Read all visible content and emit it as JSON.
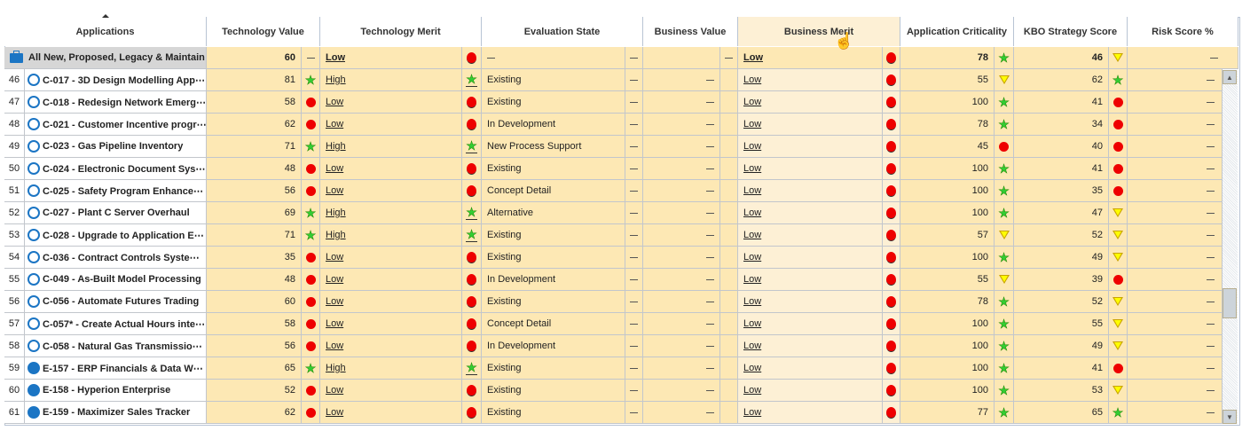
{
  "columns": [
    "Applications",
    "Technology Value",
    "Technology Merit",
    "Evaluation State",
    "Business Value",
    "Business Merit",
    "Application Criticality",
    "KBO Strategy Score",
    "Risk Score %"
  ],
  "summary": {
    "name": "All New, Proposed, Legacy & Maintain",
    "tech_value": "60",
    "tech_value_icon": "dash",
    "tech_merit": "Low",
    "tech_merit_icon": "red-dot",
    "eval_state": "—",
    "biz_merit": "Low",
    "biz_merit_icon": "red-dot",
    "criticality": "78",
    "criticality_icon": "star",
    "kbo": "46",
    "kbo_icon": "triangle"
  },
  "rows": [
    {
      "num": "46",
      "name": "C-017 - 3D Design Modelling App⋯",
      "type": "hollow",
      "tv": "81",
      "tvi": "star",
      "tm": "High",
      "tmi": "star",
      "es": "Existing",
      "bm": "Low",
      "ac": "55",
      "aci": "triangle",
      "kbo": "62",
      "kboi": "star"
    },
    {
      "num": "47",
      "name": "C-018 - Redesign Network Emerg⋯",
      "type": "hollow",
      "tv": "58",
      "tvi": "dot",
      "tm": "Low",
      "tmi": "dot",
      "es": "Existing",
      "bm": "Low",
      "ac": "100",
      "aci": "star",
      "kbo": "41",
      "kboi": "dot"
    },
    {
      "num": "48",
      "name": "C-021 - Customer Incentive progr⋯",
      "type": "hollow",
      "tv": "62",
      "tvi": "dot",
      "tm": "Low",
      "tmi": "dot",
      "es": "In Development",
      "bm": "Low",
      "ac": "78",
      "aci": "star",
      "kbo": "34",
      "kboi": "dot"
    },
    {
      "num": "49",
      "name": "C-023 - Gas Pipeline Inventory",
      "type": "hollow",
      "tv": "71",
      "tvi": "star",
      "tm": "High",
      "tmi": "star",
      "es": "New Process Support",
      "bm": "Low",
      "ac": "45",
      "aci": "dot",
      "kbo": "40",
      "kboi": "dot"
    },
    {
      "num": "50",
      "name": "C-024 - Electronic Document Sys⋯",
      "type": "hollow",
      "tv": "48",
      "tvi": "dot",
      "tm": "Low",
      "tmi": "dot",
      "es": "Existing",
      "bm": "Low",
      "ac": "100",
      "aci": "star",
      "kbo": "41",
      "kboi": "dot"
    },
    {
      "num": "51",
      "name": "C-025 - Safety Program Enhance⋯",
      "type": "hollow",
      "tv": "56",
      "tvi": "dot",
      "tm": "Low",
      "tmi": "dot",
      "es": "Concept Detail",
      "bm": "Low",
      "ac": "100",
      "aci": "star",
      "kbo": "35",
      "kboi": "dot"
    },
    {
      "num": "52",
      "name": "C-027 - Plant C Server Overhaul",
      "type": "hollow",
      "tv": "69",
      "tvi": "star",
      "tm": "High",
      "tmi": "star",
      "es": "Alternative",
      "bm": "Low",
      "ac": "100",
      "aci": "star",
      "kbo": "47",
      "kboi": "triangle"
    },
    {
      "num": "53",
      "name": "C-028 - Upgrade to Application E⋯",
      "type": "hollow",
      "tv": "71",
      "tvi": "star",
      "tm": "High",
      "tmi": "star",
      "es": "Existing",
      "bm": "Low",
      "ac": "57",
      "aci": "triangle",
      "kbo": "52",
      "kboi": "triangle"
    },
    {
      "num": "54",
      "name": "C-036 - Contract Controls Syste⋯",
      "type": "hollow",
      "tv": "35",
      "tvi": "dot",
      "tm": "Low",
      "tmi": "dot",
      "es": "Existing",
      "bm": "Low",
      "ac": "100",
      "aci": "star",
      "kbo": "49",
      "kboi": "triangle"
    },
    {
      "num": "55",
      "name": "C-049 - As-Built Model Processing",
      "type": "hollow",
      "tv": "48",
      "tvi": "dot",
      "tm": "Low",
      "tmi": "dot",
      "es": "In Development",
      "bm": "Low",
      "ac": "55",
      "aci": "triangle",
      "kbo": "39",
      "kboi": "dot"
    },
    {
      "num": "56",
      "name": "C-056 - Automate Futures Trading",
      "type": "hollow",
      "tv": "60",
      "tvi": "dot",
      "tm": "Low",
      "tmi": "dot",
      "es": "Existing",
      "bm": "Low",
      "ac": "78",
      "aci": "star",
      "kbo": "52",
      "kboi": "triangle"
    },
    {
      "num": "57",
      "name": "C-057* - Create Actual Hours inte⋯",
      "type": "hollow",
      "tv": "58",
      "tvi": "dot",
      "tm": "Low",
      "tmi": "dot",
      "es": "Concept Detail",
      "bm": "Low",
      "ac": "100",
      "aci": "star",
      "kbo": "55",
      "kboi": "triangle"
    },
    {
      "num": "58",
      "name": "C-058 - Natural Gas Transmissio⋯",
      "type": "hollow",
      "tv": "56",
      "tvi": "dot",
      "tm": "Low",
      "tmi": "dot",
      "es": "In Development",
      "bm": "Low",
      "ac": "100",
      "aci": "star",
      "kbo": "49",
      "kboi": "triangle"
    },
    {
      "num": "59",
      "name": "E-157 - ERP Financials & Data W⋯",
      "type": "filled",
      "tv": "65",
      "tvi": "star",
      "tm": "High",
      "tmi": "star",
      "es": "Existing",
      "bm": "Low",
      "ac": "100",
      "aci": "star",
      "kbo": "41",
      "kboi": "dot"
    },
    {
      "num": "60",
      "name": "E-158 - Hyperion Enterprise",
      "type": "filled",
      "tv": "52",
      "tvi": "dot",
      "tm": "Low",
      "tmi": "dot",
      "es": "Existing",
      "bm": "Low",
      "ac": "100",
      "aci": "star",
      "kbo": "53",
      "kboi": "triangle"
    },
    {
      "num": "61",
      "name": "E-159 - Maximizer Sales Tracker",
      "type": "filled",
      "tv": "62",
      "tvi": "dot",
      "tm": "Low",
      "tmi": "dot",
      "es": "Existing",
      "bm": "Low",
      "ac": "77",
      "aci": "star",
      "kbo": "65",
      "kboi": "star"
    }
  ],
  "colors": {
    "row_bg": "#fde8b4",
    "selected_col_bg": "#fdf0d5",
    "app_icon": "#1b75c4",
    "dot": "#e00000"
  }
}
